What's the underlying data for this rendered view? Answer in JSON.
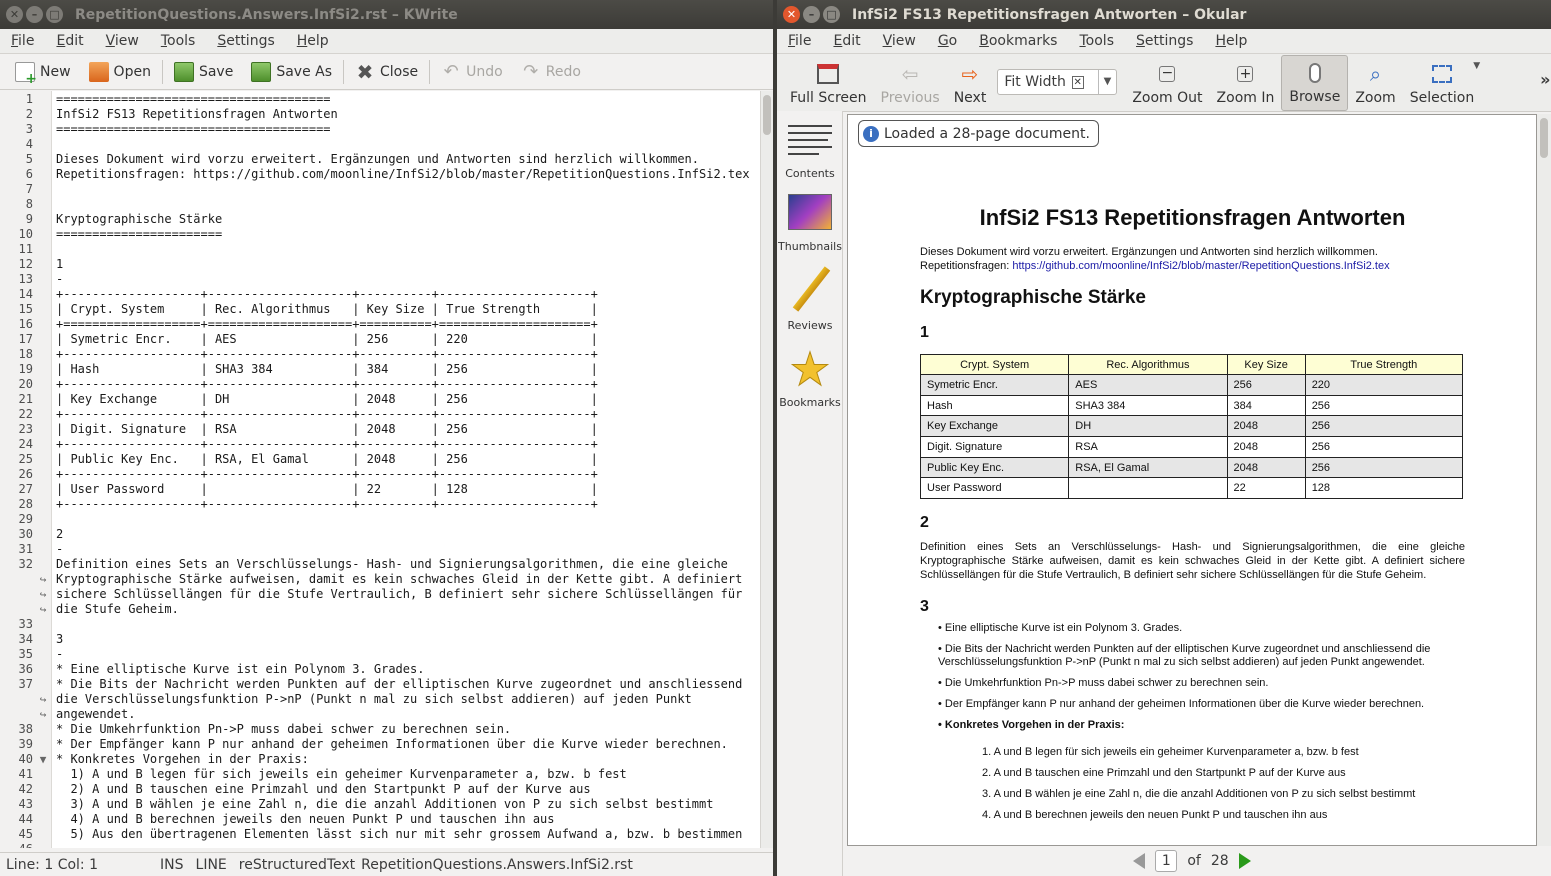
{
  "kwrite": {
    "title": "RepetitionQuestions.Answers.InfSi2.rst – KWrite",
    "menu": [
      "File",
      "Edit",
      "View",
      "Tools",
      "Settings",
      "Help"
    ],
    "toolbar": {
      "new": "New",
      "open": "Open",
      "save": "Save",
      "save_as": "Save As",
      "close": "Close",
      "undo": "Undo",
      "redo": "Redo"
    },
    "lines": [
      {
        "n": "1",
        "t": "======================================"
      },
      {
        "n": "2",
        "t": "InfSi2 FS13 Repetitionsfragen Antworten"
      },
      {
        "n": "3",
        "t": "======================================"
      },
      {
        "n": "4",
        "t": ""
      },
      {
        "n": "5",
        "t": "Dieses Dokument wird vorzu erweitert. Ergänzungen und Antworten sind herzlich willkommen."
      },
      {
        "n": "6",
        "t": "Repetitionsfragen: https://github.com/moonline/InfSi2/blob/master/RepetitionQuestions.InfSi2.tex"
      },
      {
        "n": "7",
        "t": ""
      },
      {
        "n": "8",
        "t": ""
      },
      {
        "n": "9",
        "t": "Kryptographische Stärke"
      },
      {
        "n": "10",
        "t": "======================="
      },
      {
        "n": "11",
        "t": ""
      },
      {
        "n": "12",
        "t": "1"
      },
      {
        "n": "13",
        "t": "-"
      },
      {
        "n": "14",
        "t": "+-------------------+--------------------+----------+---------------------+"
      },
      {
        "n": "15",
        "t": "| Crypt. System     | Rec. Algorithmus   | Key Size | True Strength       |"
      },
      {
        "n": "16",
        "t": "+===================+====================+==========+=====================+"
      },
      {
        "n": "17",
        "t": "| Symetric Encr.    | AES                | 256      | 220                 |"
      },
      {
        "n": "18",
        "t": "+-------------------+--------------------+----------+---------------------+"
      },
      {
        "n": "19",
        "t": "| Hash              | SHA3 384           | 384      | 256                 |"
      },
      {
        "n": "20",
        "t": "+-------------------+--------------------+----------+---------------------+"
      },
      {
        "n": "21",
        "t": "| Key Exchange      | DH                 | 2048     | 256                 |"
      },
      {
        "n": "22",
        "t": "+-------------------+--------------------+----------+---------------------+"
      },
      {
        "n": "23",
        "t": "| Digit. Signature  | RSA                | 2048     | 256                 |"
      },
      {
        "n": "24",
        "t": "+-------------------+--------------------+----------+---------------------+"
      },
      {
        "n": "25",
        "t": "| Public Key Enc.   | RSA, El Gamal      | 2048     | 256                 |"
      },
      {
        "n": "26",
        "t": "+-------------------+--------------------+----------+---------------------+"
      },
      {
        "n": "27",
        "t": "| User Password     |                    | 22       | 128                 |"
      },
      {
        "n": "28",
        "t": "+-------------------+--------------------+----------+---------------------+"
      },
      {
        "n": "29",
        "t": ""
      },
      {
        "n": "30",
        "t": "2"
      },
      {
        "n": "31",
        "t": "-"
      },
      {
        "n": "32",
        "t": "Definition eines Sets an Verschlüsselungs- Hash- und Signierungsalgorithmen, die eine gleiche"
      },
      {
        "n": "",
        "t": "Kryptographische Stärke aufweisen, damit es kein schwaches Gleid in der Kette gibt. A definiert"
      },
      {
        "n": "",
        "t": "sichere Schlüssellängen für die Stufe Vertraulich, B definiert sehr sichere Schlüssellängen für"
      },
      {
        "n": "",
        "t": "die Stufe Geheim."
      },
      {
        "n": "33",
        "t": ""
      },
      {
        "n": "34",
        "t": "3"
      },
      {
        "n": "35",
        "t": "-"
      },
      {
        "n": "36",
        "t": "* Eine elliptische Kurve ist ein Polynom 3. Grades."
      },
      {
        "n": "37",
        "t": "* Die Bits der Nachricht werden Punkten auf der elliptischen Kurve zugeordnet und anschliessend"
      },
      {
        "n": "",
        "t": "die Verschlüsselungsfunktion P->nP (Punkt n mal zu sich selbst addieren) auf jeden Punkt"
      },
      {
        "n": "",
        "t": "angewendet."
      },
      {
        "n": "38",
        "t": "* Die Umkehrfunktion Pn->P muss dabei schwer zu berechnen sein."
      },
      {
        "n": "39",
        "t": "* Der Empfänger kann P nur anhand der geheimen Informationen über die Kurve wieder berechnen."
      },
      {
        "n": "40",
        "t": "* Konkretes Vorgehen in der Praxis:"
      },
      {
        "n": "41",
        "t": "  1) A und B legen für sich jeweils ein geheimer Kurvenparameter a, bzw. b fest"
      },
      {
        "n": "42",
        "t": "  2) A und B tauschen eine Primzahl und den Startpunkt P auf der Kurve aus"
      },
      {
        "n": "43",
        "t": "  3) A und B wählen je eine Zahl n, die die anzahl Additionen von P zu sich selbst bestimmt"
      },
      {
        "n": "44",
        "t": "  4) A und B berechnen jeweils den neuen Punkt P und tauschen ihn aus"
      },
      {
        "n": "45",
        "t": "  5) Aus den übertragenen Elementen lässt sich nur mit sehr grossem Aufwand a, bzw. b bestimmen"
      },
      {
        "n": "46",
        "t": ""
      }
    ],
    "status": {
      "pos": "Line: 1 Col: 1",
      "mode": "INS",
      "sel": "LINE",
      "syntax": "reStructuredText",
      "file": "RepetitionQuestions.Answers.InfSi2.rst"
    }
  },
  "okular": {
    "title": "InfSi2 FS13 Repetitionsfragen Antworten – Okular",
    "menu": [
      "File",
      "Edit",
      "View",
      "Go",
      "Bookmarks",
      "Tools",
      "Settings",
      "Help"
    ],
    "toolbar": {
      "fullscreen": "Full Screen",
      "previous": "Previous",
      "next": "Next",
      "fit": "Fit Width",
      "zoom_out": "Zoom Out",
      "zoom_in": "Zoom In",
      "browse": "Browse",
      "zoom": "Zoom",
      "selection": "Selection",
      "more": "»"
    },
    "sidebar": [
      "Contents",
      "Thumbnails",
      "Reviews",
      "Bookmarks"
    ],
    "message": "Loaded a 28-page document.",
    "page": {
      "title": "InfSi2 FS13 Repetitionsfragen Antworten",
      "intro": "Dieses Dokument wird vorzu erweitert. Ergänzungen und Antworten sind herzlich willkommen.",
      "repetitions_label": "Repetitionsfragen:",
      "link": "https://github.com/moonline/InfSi2/blob/master/RepetitionQuestions.InfSi2.tex",
      "section": "Kryptographische Stärke",
      "h1": "1",
      "table_headers": [
        "Crypt. System",
        "Rec. Algorithmus",
        "Key Size",
        "True Strength"
      ],
      "table_rows": [
        [
          "Symetric Encr.",
          "AES",
          "256",
          "220"
        ],
        [
          "Hash",
          "SHA3 384",
          "384",
          "256"
        ],
        [
          "Key Exchange",
          "DH",
          "2048",
          "256"
        ],
        [
          "Digit. Signature",
          "RSA",
          "2048",
          "256"
        ],
        [
          "Public Key Enc.",
          "RSA, El Gamal",
          "2048",
          "256"
        ],
        [
          "User Password",
          "",
          "22",
          "128"
        ]
      ],
      "h2": "2",
      "para2": "Definition eines Sets an Verschlüsselungs- Hash- und Signierungsalgorithmen, die eine gleiche Kryptographische Stärke aufweisen, damit es kein schwaches Gleid in der Kette gibt. A definiert sichere Schlüssellängen für die Stufe Vertraulich, B definiert sehr sichere Schlüssellängen für die Stufe Geheim.",
      "h3": "3",
      "bullets": [
        "• Eine elliptische Kurve ist ein Polynom 3. Grades.",
        "• Die Bits der Nachricht werden Punkten auf der elliptischen Kurve zugeordnet und anschliessend die Verschlüsselungsfunktion P->nP (Punkt n mal zu sich selbst addieren) auf jeden Punkt angewendet.",
        "• Die Umkehrfunktion Pn->P muss dabei schwer zu berechnen sein.",
        "• Der Empfänger kann P nur anhand der geheimen Informationen über die Kurve wieder berechnen.",
        "• Konkretes Vorgehen in der Praxis:"
      ],
      "steps": [
        "1. A und B legen für sich jeweils ein geheimer Kurvenparameter a, bzw. b fest",
        "2. A und B tauschen eine Primzahl und den Startpunkt P auf der Kurve aus",
        "3. A und B wählen je eine Zahl n, die die anzahl Additionen von P zu sich selbst bestimmt",
        "4. A und B berechnen jeweils den neuen Punkt P und tauschen ihn aus"
      ]
    },
    "pager": {
      "current": "1",
      "of": "of",
      "total": "28"
    }
  }
}
